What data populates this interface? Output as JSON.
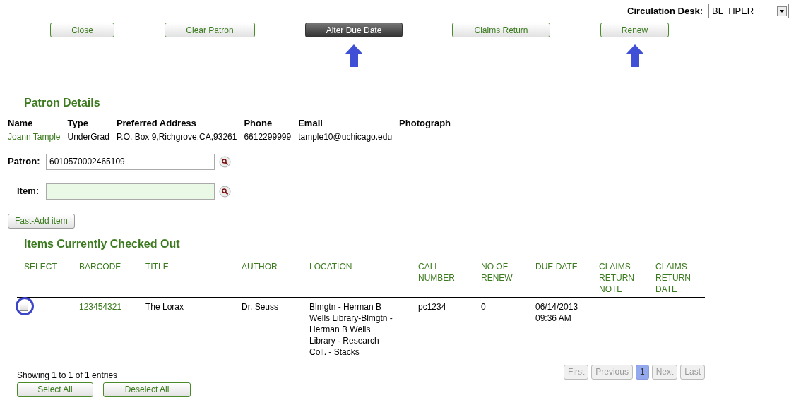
{
  "circulation_desk": {
    "label": "Circulation Desk:",
    "value": "BL_HPER"
  },
  "actions": [
    {
      "label": "Close",
      "selected": false,
      "arrow": false
    },
    {
      "label": "Clear Patron",
      "selected": false,
      "arrow": false
    },
    {
      "label": "Alter Due Date",
      "selected": true,
      "arrow": true
    },
    {
      "label": "Claims Return",
      "selected": false,
      "arrow": false
    },
    {
      "label": "Renew",
      "selected": false,
      "arrow": true
    }
  ],
  "patron_details": {
    "title": "Patron Details",
    "fields": [
      {
        "label": "Name",
        "value": "Joann Tample",
        "kind": "link"
      },
      {
        "label": "Type",
        "value": "UnderGrad",
        "kind": "text"
      },
      {
        "label": "Preferred Address",
        "value": "P.O. Box 9,Richgrove,CA,93261",
        "kind": "text"
      },
      {
        "label": "Phone",
        "value": "6612299999",
        "kind": "text"
      },
      {
        "label": "Email",
        "value": "tample10@uchicago.edu",
        "kind": "text"
      },
      {
        "label": "Photograph",
        "kind": "empty"
      }
    ]
  },
  "patron_field": {
    "label": "Patron:",
    "value": "6010570002465109"
  },
  "item_field": {
    "label": "Item:"
  },
  "fast_add_button": "Fast-Add item",
  "checked_out": {
    "title": "Items Currently Checked Out",
    "columns": [
      "SELECT",
      "BARCODE",
      "TITLE",
      "AUTHOR",
      "LOCATION",
      "CALL NUMBER",
      "NO OF RENEW",
      "DUE DATE",
      "CLAIMS RETURN NOTE",
      "CLAIMS RETURN DATE"
    ],
    "rows": [
      {
        "checked": false,
        "circled": true,
        "barcode": "123454321",
        "title": "The Lorax",
        "author": "Dr. Seuss",
        "location": "Blmgtn - Herman B Wells Library-Blmgtn - Herman B Wells Library - Research Coll. - Stacks",
        "call_number": "pc1234",
        "renewals": "0",
        "due_date": "06/14/2013 09:36 AM"
      }
    ],
    "info": "Showing 1 to 1 of 1 entries",
    "pagination": [
      {
        "label": "First",
        "selected": false,
        "disabled": true
      },
      {
        "label": "Previous",
        "selected": false,
        "disabled": true
      },
      {
        "label": "1",
        "selected": true,
        "disabled": false
      },
      {
        "label": "Next",
        "selected": false,
        "disabled": true
      },
      {
        "label": "Last",
        "selected": false,
        "disabled": true
      }
    ],
    "buttons": [
      "Select All",
      "Deselect All"
    ]
  }
}
